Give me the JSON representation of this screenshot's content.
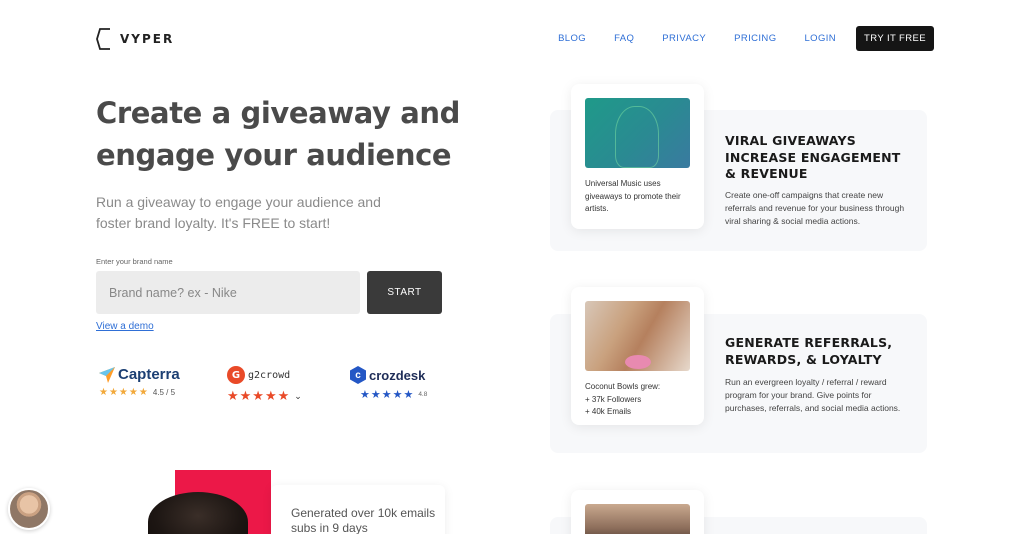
{
  "header": {
    "logo_text": "VYPER",
    "nav": [
      "BLOG",
      "FAQ",
      "PRIVACY",
      "PRICING",
      "LOGIN"
    ],
    "cta_label": "TRY IT FREE"
  },
  "hero": {
    "title": "Create a giveaway and engage your audience",
    "subtitle": "Run a giveaway to engage your audience and foster brand loyalty. It's FREE to start!",
    "brand_label": "Enter your brand name",
    "brand_placeholder": "Brand name? ex - Nike",
    "start_label": "START",
    "demo_link": "View a demo"
  },
  "reviews": {
    "capterra": {
      "name": "Capterra",
      "stars": "★★★★★",
      "score": "4.5 / 5"
    },
    "g2": {
      "name": "g2crowd",
      "mark": "G",
      "stars": "★★★★★",
      "arrow": "⌄"
    },
    "crozdesk": {
      "name": "crozdesk",
      "mark": "c",
      "stars": "★★★★★",
      "score": "4.8"
    }
  },
  "showcase": {
    "stat_text": "Generated over 10k emails subs in 9 days"
  },
  "features": [
    {
      "caption": "Universal Music uses giveaways to promote their artists.",
      "title": "VIRAL GIVEAWAYS INCREASE ENGAGEMENT & REVENUE",
      "desc": "Create one-off campaigns that create new referrals and revenue for your business through viral sharing & social media actions."
    },
    {
      "caption": "Coconut Bowls grew:\n+ 37k Followers\n+ 40k Emails",
      "title": "GENERATE REFERRALS, REWARDS, & LOYALTY",
      "desc": "Run an evergreen loyalty / referral / reward program for your brand. Give points for purchases, referrals, and social media actions."
    }
  ],
  "colors": {
    "accent": "#2f6fd6",
    "cta_bg": "#151515",
    "red": "#ec1848"
  }
}
